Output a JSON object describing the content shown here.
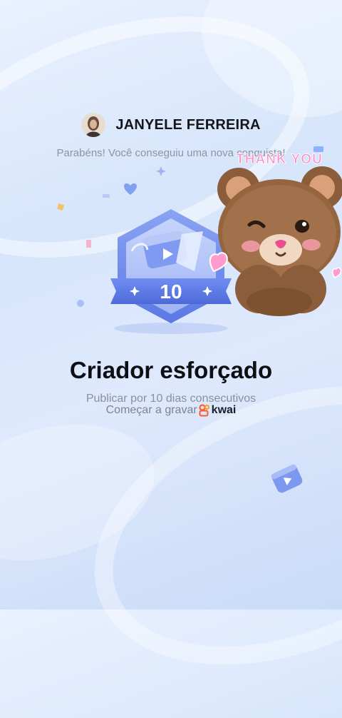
{
  "user": {
    "name": "JANYELE FERREIRA"
  },
  "congrats_text": "Parabéns! Você conseguiu uma nova conquista!",
  "badge": {
    "number": "10"
  },
  "achievement": {
    "title": "Criador esforçado",
    "description": "Publicar por 10 dias consecutivos"
  },
  "cta": {
    "text": "Começar a gravar",
    "brand": "kwai"
  },
  "sticker": {
    "text": "THANK YOU"
  },
  "colors": {
    "accent": "#5b7bea",
    "brand": "#ff5b2b",
    "sticker_text": "#ff8cc6"
  }
}
